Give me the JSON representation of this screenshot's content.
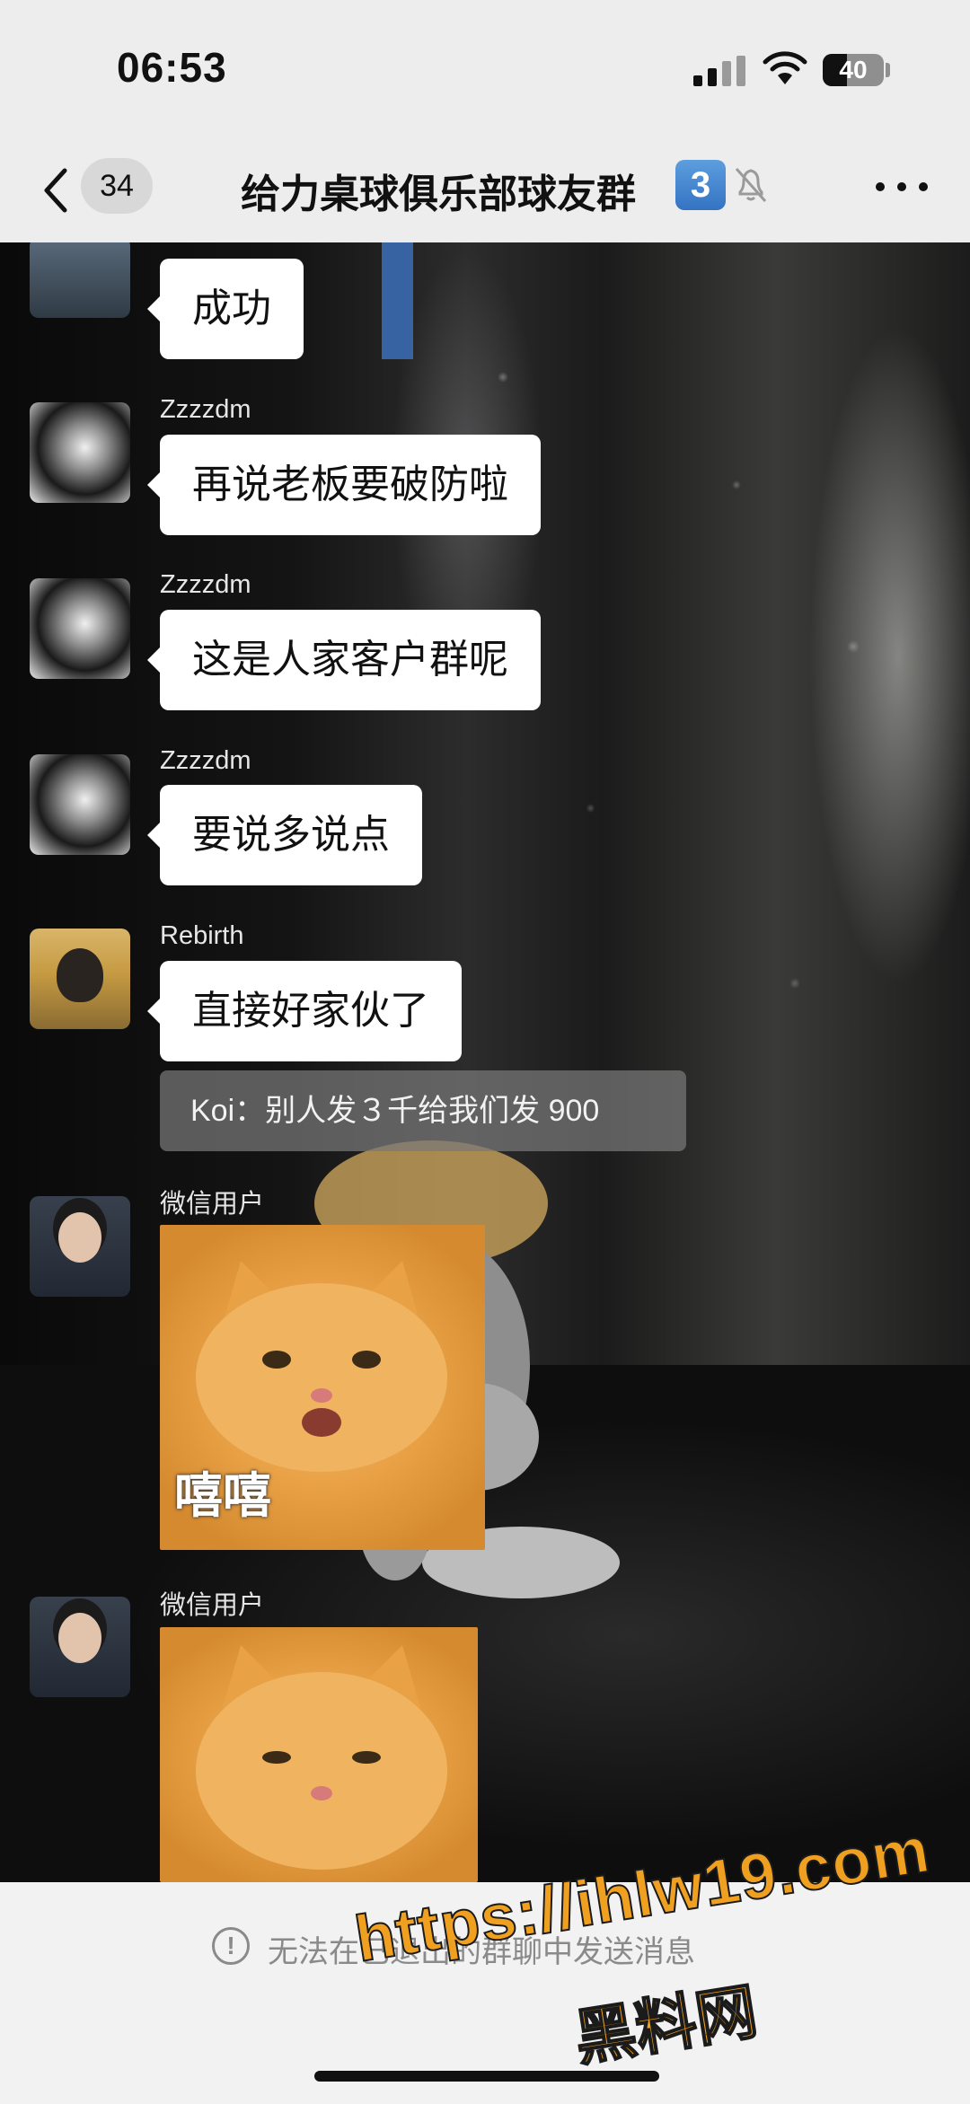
{
  "status_bar": {
    "time": "06:53",
    "battery": "40",
    "battery_level": 0.4,
    "icons": [
      "signal-icon",
      "wifi-icon",
      "battery-icon"
    ]
  },
  "header": {
    "back_icon": "chevron-left-icon",
    "unread_count": "34",
    "title": "给力桌球俱乐部球友群",
    "badge": "3",
    "mute_icon": "bell-off-icon",
    "more_icon": "more-icon"
  },
  "messages": [
    {
      "sender": "",
      "text": "成功"
    },
    {
      "sender": "Zzzzdm",
      "text": "再说老板要破防啦"
    },
    {
      "sender": "Zzzzdm",
      "text": "这是人家客户群呢"
    },
    {
      "sender": "Zzzzdm",
      "text": "要说多说点"
    },
    {
      "sender": "Rebirth",
      "text": "直接好家伙了",
      "quote": "Koi：别人发３千给我们发 900"
    },
    {
      "sender": "微信用户",
      "sticker_text": "嘻嘻"
    },
    {
      "sender": "微信用户",
      "sticker_text": ""
    }
  ],
  "bottom": {
    "notice_icon": "info-circle-icon",
    "notice": "无法在已退出的群聊中发送消息"
  },
  "watermark": {
    "url": "https://ihlw19.com",
    "name": "黑料网"
  },
  "colors": {
    "header_bg": "#ededed",
    "bubble_bg": "#ffffff",
    "badge_blue": "#3473c2",
    "watermark": "#f0a020"
  }
}
